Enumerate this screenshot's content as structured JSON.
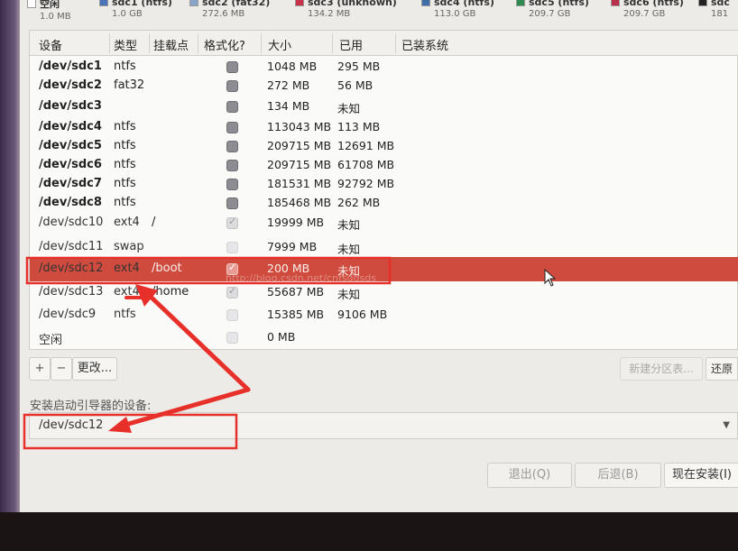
{
  "colors": {
    "selected_row": "#cf4b3e",
    "annotation": "#e8302a",
    "panel": "#ecebe7"
  },
  "legend": [
    {
      "name": "空闲",
      "size": "1.0 MB",
      "color": "#ffffff"
    },
    {
      "name": "sdc1 (ntfs)",
      "size": "1.0 GB",
      "color": "#4a73b8"
    },
    {
      "name": "sdc2 (fat32)",
      "size": "272.6 MB",
      "color": "#8aa3c9"
    },
    {
      "name": "sdc3 (unknown)",
      "size": "134.2 MB",
      "color": "#c8324a"
    },
    {
      "name": "sdc4 (ntfs)",
      "size": "113.0 GB",
      "color": "#3f6fa8"
    },
    {
      "name": "sdc5 (ntfs)",
      "size": "209.7 GB",
      "color": "#2e8a4f"
    },
    {
      "name": "sdc6 (ntfs)",
      "size": "209.7 GB",
      "color": "#b8304a"
    },
    {
      "name": "sdc",
      "size": "181",
      "color": "#222222"
    }
  ],
  "table": {
    "headers": [
      "设备",
      "类型",
      "挂载点",
      "格式化?",
      "大小",
      "已用",
      "已装系统"
    ],
    "rows": [
      {
        "device": "/dev/sdc1",
        "type": "ntfs",
        "mount": "",
        "format": "checked",
        "size": "1048 MB",
        "used": "295 MB"
      },
      {
        "device": "/dev/sdc2",
        "type": "fat32",
        "mount": "",
        "format": "checked",
        "size": "272 MB",
        "used": "56 MB"
      },
      {
        "device": "/dev/sdc3",
        "type": "",
        "mount": "",
        "format": "checked",
        "size": "134 MB",
        "used": "未知"
      },
      {
        "device": "/dev/sdc4",
        "type": "ntfs",
        "mount": "",
        "format": "checked",
        "size": "113043 MB",
        "used": "113 MB"
      },
      {
        "device": "/dev/sdc5",
        "type": "ntfs",
        "mount": "",
        "format": "checked",
        "size": "209715 MB",
        "used": "12691 MB"
      },
      {
        "device": "/dev/sdc6",
        "type": "ntfs",
        "mount": "",
        "format": "checked",
        "size": "209715 MB",
        "used": "61708 MB"
      },
      {
        "device": "/dev/sdc7",
        "type": "ntfs",
        "mount": "",
        "format": "checked",
        "size": "181531 MB",
        "used": "92792 MB"
      },
      {
        "device": "/dev/sdc8",
        "type": "ntfs",
        "mount": "",
        "format": "checked",
        "size": "185468 MB",
        "used": "262 MB"
      },
      {
        "device": "/dev/sdc10",
        "type": "ext4",
        "mount": "/",
        "format": "light",
        "size": "19999 MB",
        "used": "未知"
      },
      {
        "device": "/dev/sdc11",
        "type": "swap",
        "mount": "",
        "format": "empty",
        "size": "7999 MB",
        "used": "未知"
      },
      {
        "device": "/dev/sdc12",
        "type": "ext4",
        "mount": "/boot",
        "format": "selected",
        "size": "200 MB",
        "used": "未知"
      },
      {
        "device": "/dev/sdc13",
        "type": "ext4",
        "mount": "/home",
        "format": "light",
        "size": "55687 MB",
        "used": "未知"
      },
      {
        "device": "/dev/sdc9",
        "type": "ntfs",
        "mount": "",
        "format": "empty",
        "size": "15385 MB",
        "used": "9106 MB"
      },
      {
        "device": "空闲",
        "type": "",
        "mount": "",
        "format": "empty",
        "size": "0 MB",
        "used": ""
      }
    ]
  },
  "toolbar": {
    "add": "+",
    "remove": "−",
    "change": "更改...",
    "new_partition_table": "新建分区表...",
    "revert": "还原"
  },
  "boot": {
    "label": "安装启动引导器的设备:",
    "value": "/dev/sdc12"
  },
  "actions": {
    "quit": "退出(Q)",
    "back": "后退(B)",
    "install": "现在安装(I)"
  },
  "watermark": "http://blog.csdn.net/cnfsdgsds"
}
